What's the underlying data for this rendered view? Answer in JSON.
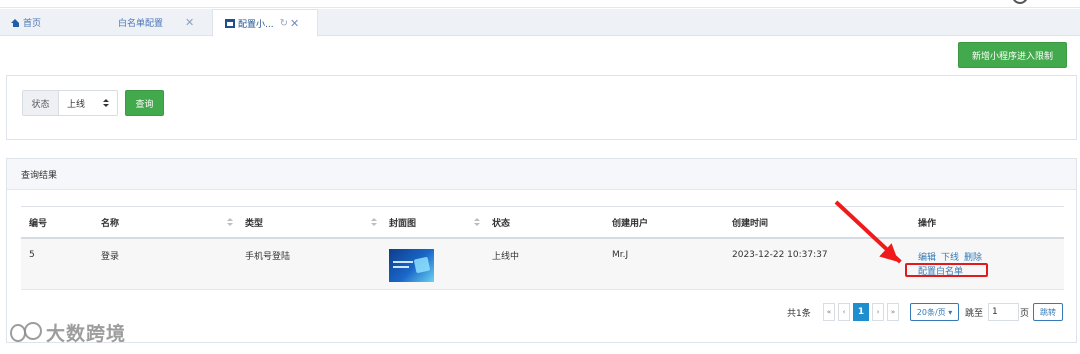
{
  "tabs": {
    "home": "首页",
    "whitelist": "白名单配置",
    "active": "配置小..."
  },
  "toolbar": {
    "add_button": "新增小程序进入限制"
  },
  "search": {
    "status_label": "状态",
    "status_value": "上线",
    "query_button": "查询"
  },
  "results": {
    "title": "查询结果",
    "columns": [
      "编号",
      "名称",
      "类型",
      "封面图",
      "状态",
      "创建用户",
      "创建时间",
      "操作"
    ],
    "rows": [
      {
        "id": "5",
        "name": "登录",
        "type": "手机号登陆",
        "status": "上线中",
        "creator": "Mr.J",
        "created_at": "2023-12-22 10:37:37",
        "actions": [
          "编辑",
          "下线",
          "删除"
        ],
        "action_whitelist": "配置白名单"
      }
    ]
  },
  "pagination": {
    "total": "共1条",
    "first": "«",
    "prev": "‹",
    "current": "1",
    "next": "›",
    "last": "»",
    "page_size": "20条/页 ▾",
    "jump_label": "跳至",
    "jump_value": "1",
    "page_unit": "页",
    "jump_button": "跳转"
  },
  "watermark": "大数跨境",
  "colors": {
    "primary_green": "#43a94d",
    "link_blue": "#337ab7",
    "highlight_red": "#e11b1b"
  }
}
